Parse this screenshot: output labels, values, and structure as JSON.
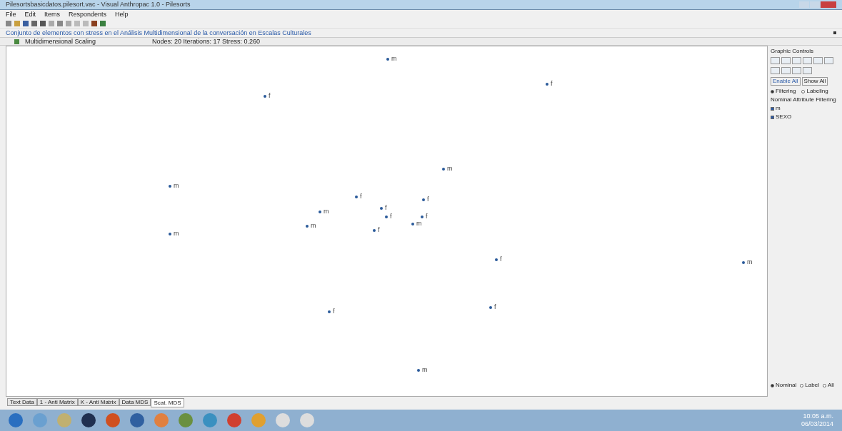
{
  "window": {
    "title": "Pilesortsbasicdatos.pilesort.vac - Visual Anthropac 1.0 - Pilesorts"
  },
  "menu": [
    "File",
    "Edit",
    "Items",
    "Respondents",
    "Help"
  ],
  "caption": "Conjunto de elementos con stress en el Análisis Multidimensional de la conversación en Escalas Culturales",
  "panel_header": {
    "title": "Multidimensional Scaling",
    "stats": "Nodes: 20   Iterations: 17   Stress: 0.260"
  },
  "points": [
    {
      "label": "m"
    },
    {
      "label": "f"
    },
    {
      "label": "f"
    },
    {
      "label": "m"
    },
    {
      "label": "m"
    },
    {
      "label": "f"
    },
    {
      "label": "f"
    },
    {
      "label": "f"
    },
    {
      "label": "m"
    },
    {
      "label": "f"
    },
    {
      "label": "f"
    },
    {
      "label": "m"
    },
    {
      "label": "m"
    },
    {
      "label": "f"
    },
    {
      "label": "m"
    },
    {
      "label": "f"
    },
    {
      "label": "m"
    },
    {
      "label": "f"
    },
    {
      "label": "f"
    },
    {
      "label": "m"
    }
  ],
  "controls": {
    "title": "Graphic Controls",
    "enable": "Enable All",
    "show": "Show All",
    "modes": [
      {
        "label": "Filtering",
        "selected": true
      },
      {
        "label": "Labeling",
        "selected": false
      }
    ],
    "filter_title": "Nominal Attribute Filtering",
    "filters": [
      {
        "label": "m",
        "checked": true
      },
      {
        "label": "SEXO",
        "checked": true
      }
    ],
    "bottom_modes": [
      {
        "label": "Nominal",
        "selected": true
      },
      {
        "label": "Label",
        "selected": false
      },
      {
        "label": "All",
        "selected": false
      }
    ]
  },
  "tabs": [
    {
      "label": "Text Data",
      "selected": false
    },
    {
      "label": "1 - Anti Matrix",
      "selected": false
    },
    {
      "label": "K - Anti Matrix",
      "selected": false
    },
    {
      "label": "Data MDS",
      "selected": false
    },
    {
      "label": "Scat. MDS",
      "selected": true
    }
  ],
  "clock": {
    "time": "10:05 a.m.",
    "date": "06/03/2014"
  }
}
